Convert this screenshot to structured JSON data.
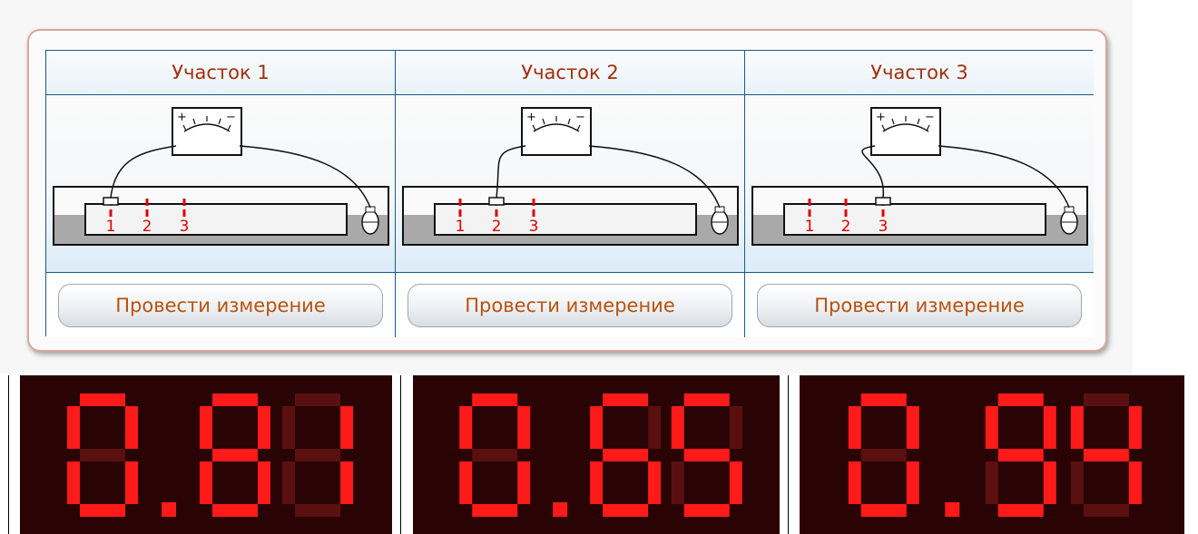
{
  "sections": [
    {
      "title": "Участок 1",
      "button_label": "Провести измерение",
      "probe_point": 1,
      "point_labels": [
        "1",
        "2",
        "3"
      ]
    },
    {
      "title": "Участок 2",
      "button_label": "Провести измерение",
      "probe_point": 2,
      "point_labels": [
        "1",
        "2",
        "3"
      ]
    },
    {
      "title": "Участок 3",
      "button_label": "Провести измерение",
      "probe_point": 3,
      "point_labels": [
        "1",
        "2",
        "3"
      ]
    }
  ],
  "meter": {
    "plus_sign": "+",
    "minus_sign": "−"
  },
  "readings": [
    "0.81",
    "0.65",
    "0.94"
  ],
  "colors": {
    "header_text": "#a0300d",
    "button_text": "#b8520e",
    "grid_border": "#1c5b86",
    "led_on": "#ff1a1a",
    "led_off": "#5a1010",
    "display_bg": "#2a0404"
  }
}
